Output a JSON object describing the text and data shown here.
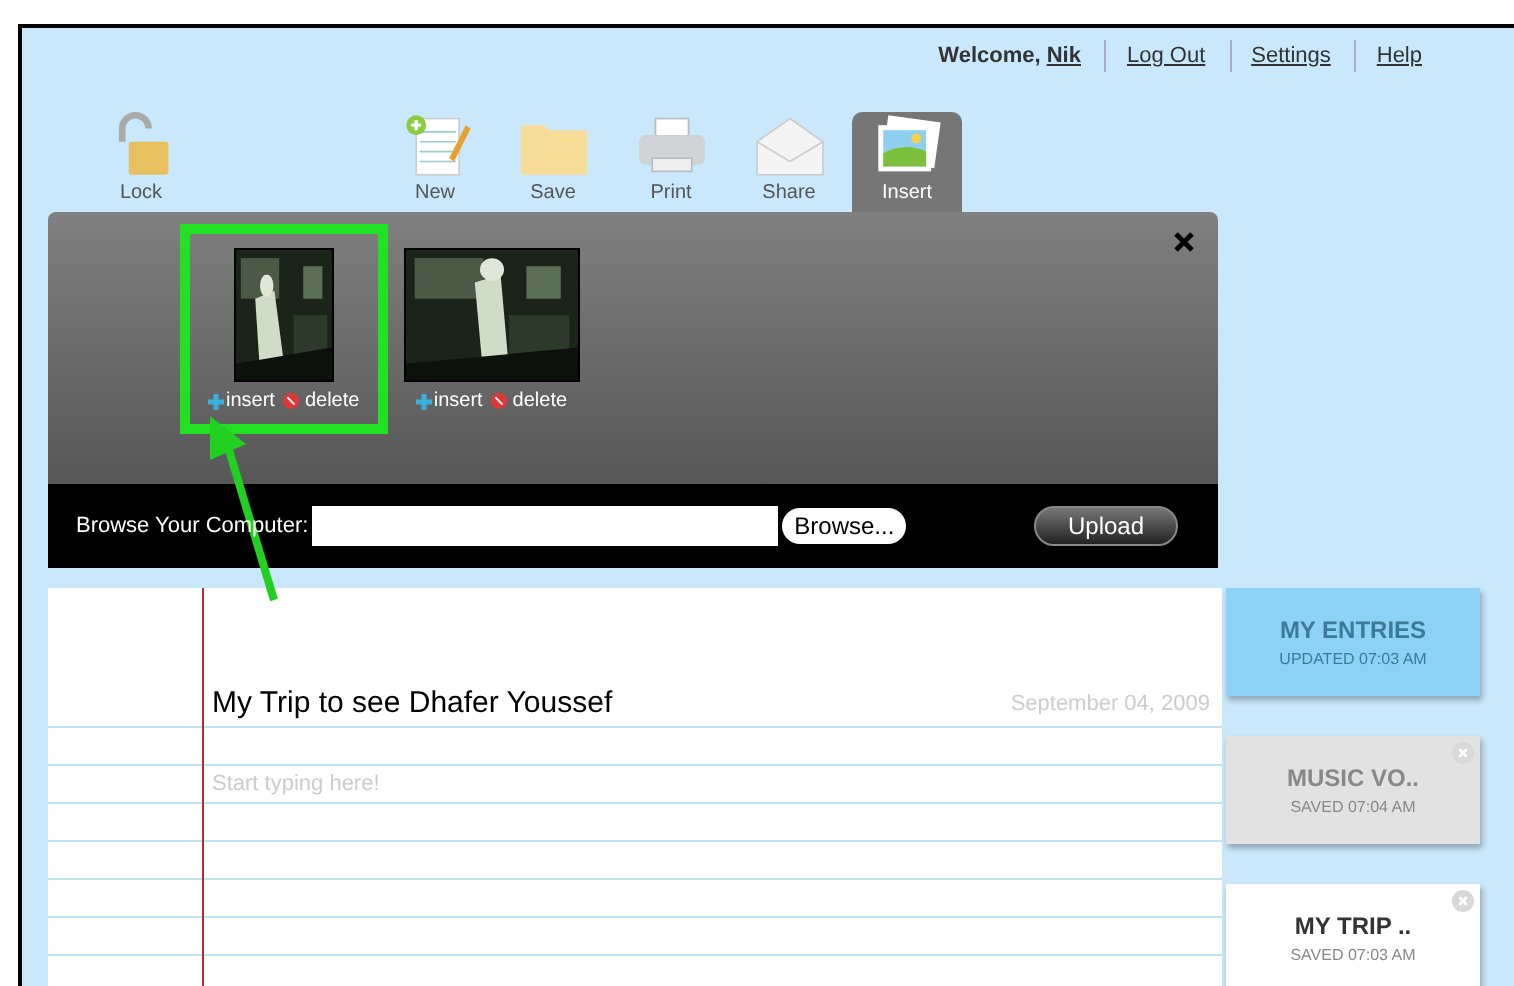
{
  "header": {
    "welcome": "Welcome,",
    "user": "Nik",
    "links": [
      "Log Out",
      "Settings",
      "Help"
    ]
  },
  "toolbar": [
    {
      "label": "Lock",
      "kind": "lock",
      "selected": false
    },
    {
      "label": "New",
      "kind": "new",
      "selected": false
    },
    {
      "label": "Save",
      "kind": "save",
      "selected": false
    },
    {
      "label": "Print",
      "kind": "print",
      "selected": false
    },
    {
      "label": "Share",
      "kind": "share",
      "selected": false
    },
    {
      "label": "Insert",
      "kind": "insert",
      "selected": true
    }
  ],
  "insert_panel": {
    "images": [
      {
        "kind": "picture",
        "insert": "insert",
        "delete": "delete",
        "highlighted": true
      },
      {
        "kind": "picture",
        "insert": "insert",
        "delete": "delete",
        "highlighted": false
      }
    ],
    "browse_label": "Browse Your Computer:",
    "browse_button": "Browse...",
    "upload_button": "Upload"
  },
  "entry": {
    "title": "My Trip to see Dhafer Youssef",
    "date": "September 04, 2009",
    "placeholder": "Start typing here!"
  },
  "entries": [
    {
      "kind": "summary",
      "title": "MY ENTRIES",
      "subtitle": "UPDATED 07:03 AM",
      "selected": false
    },
    {
      "kind": "entry",
      "title": "MUSIC VO..",
      "subtitle": "SAVED 07:04 AM",
      "selected": false
    },
    {
      "kind": "entry",
      "title": "MY TRIP ..",
      "subtitle": "SAVED 07:03 AM",
      "selected": true
    }
  ]
}
